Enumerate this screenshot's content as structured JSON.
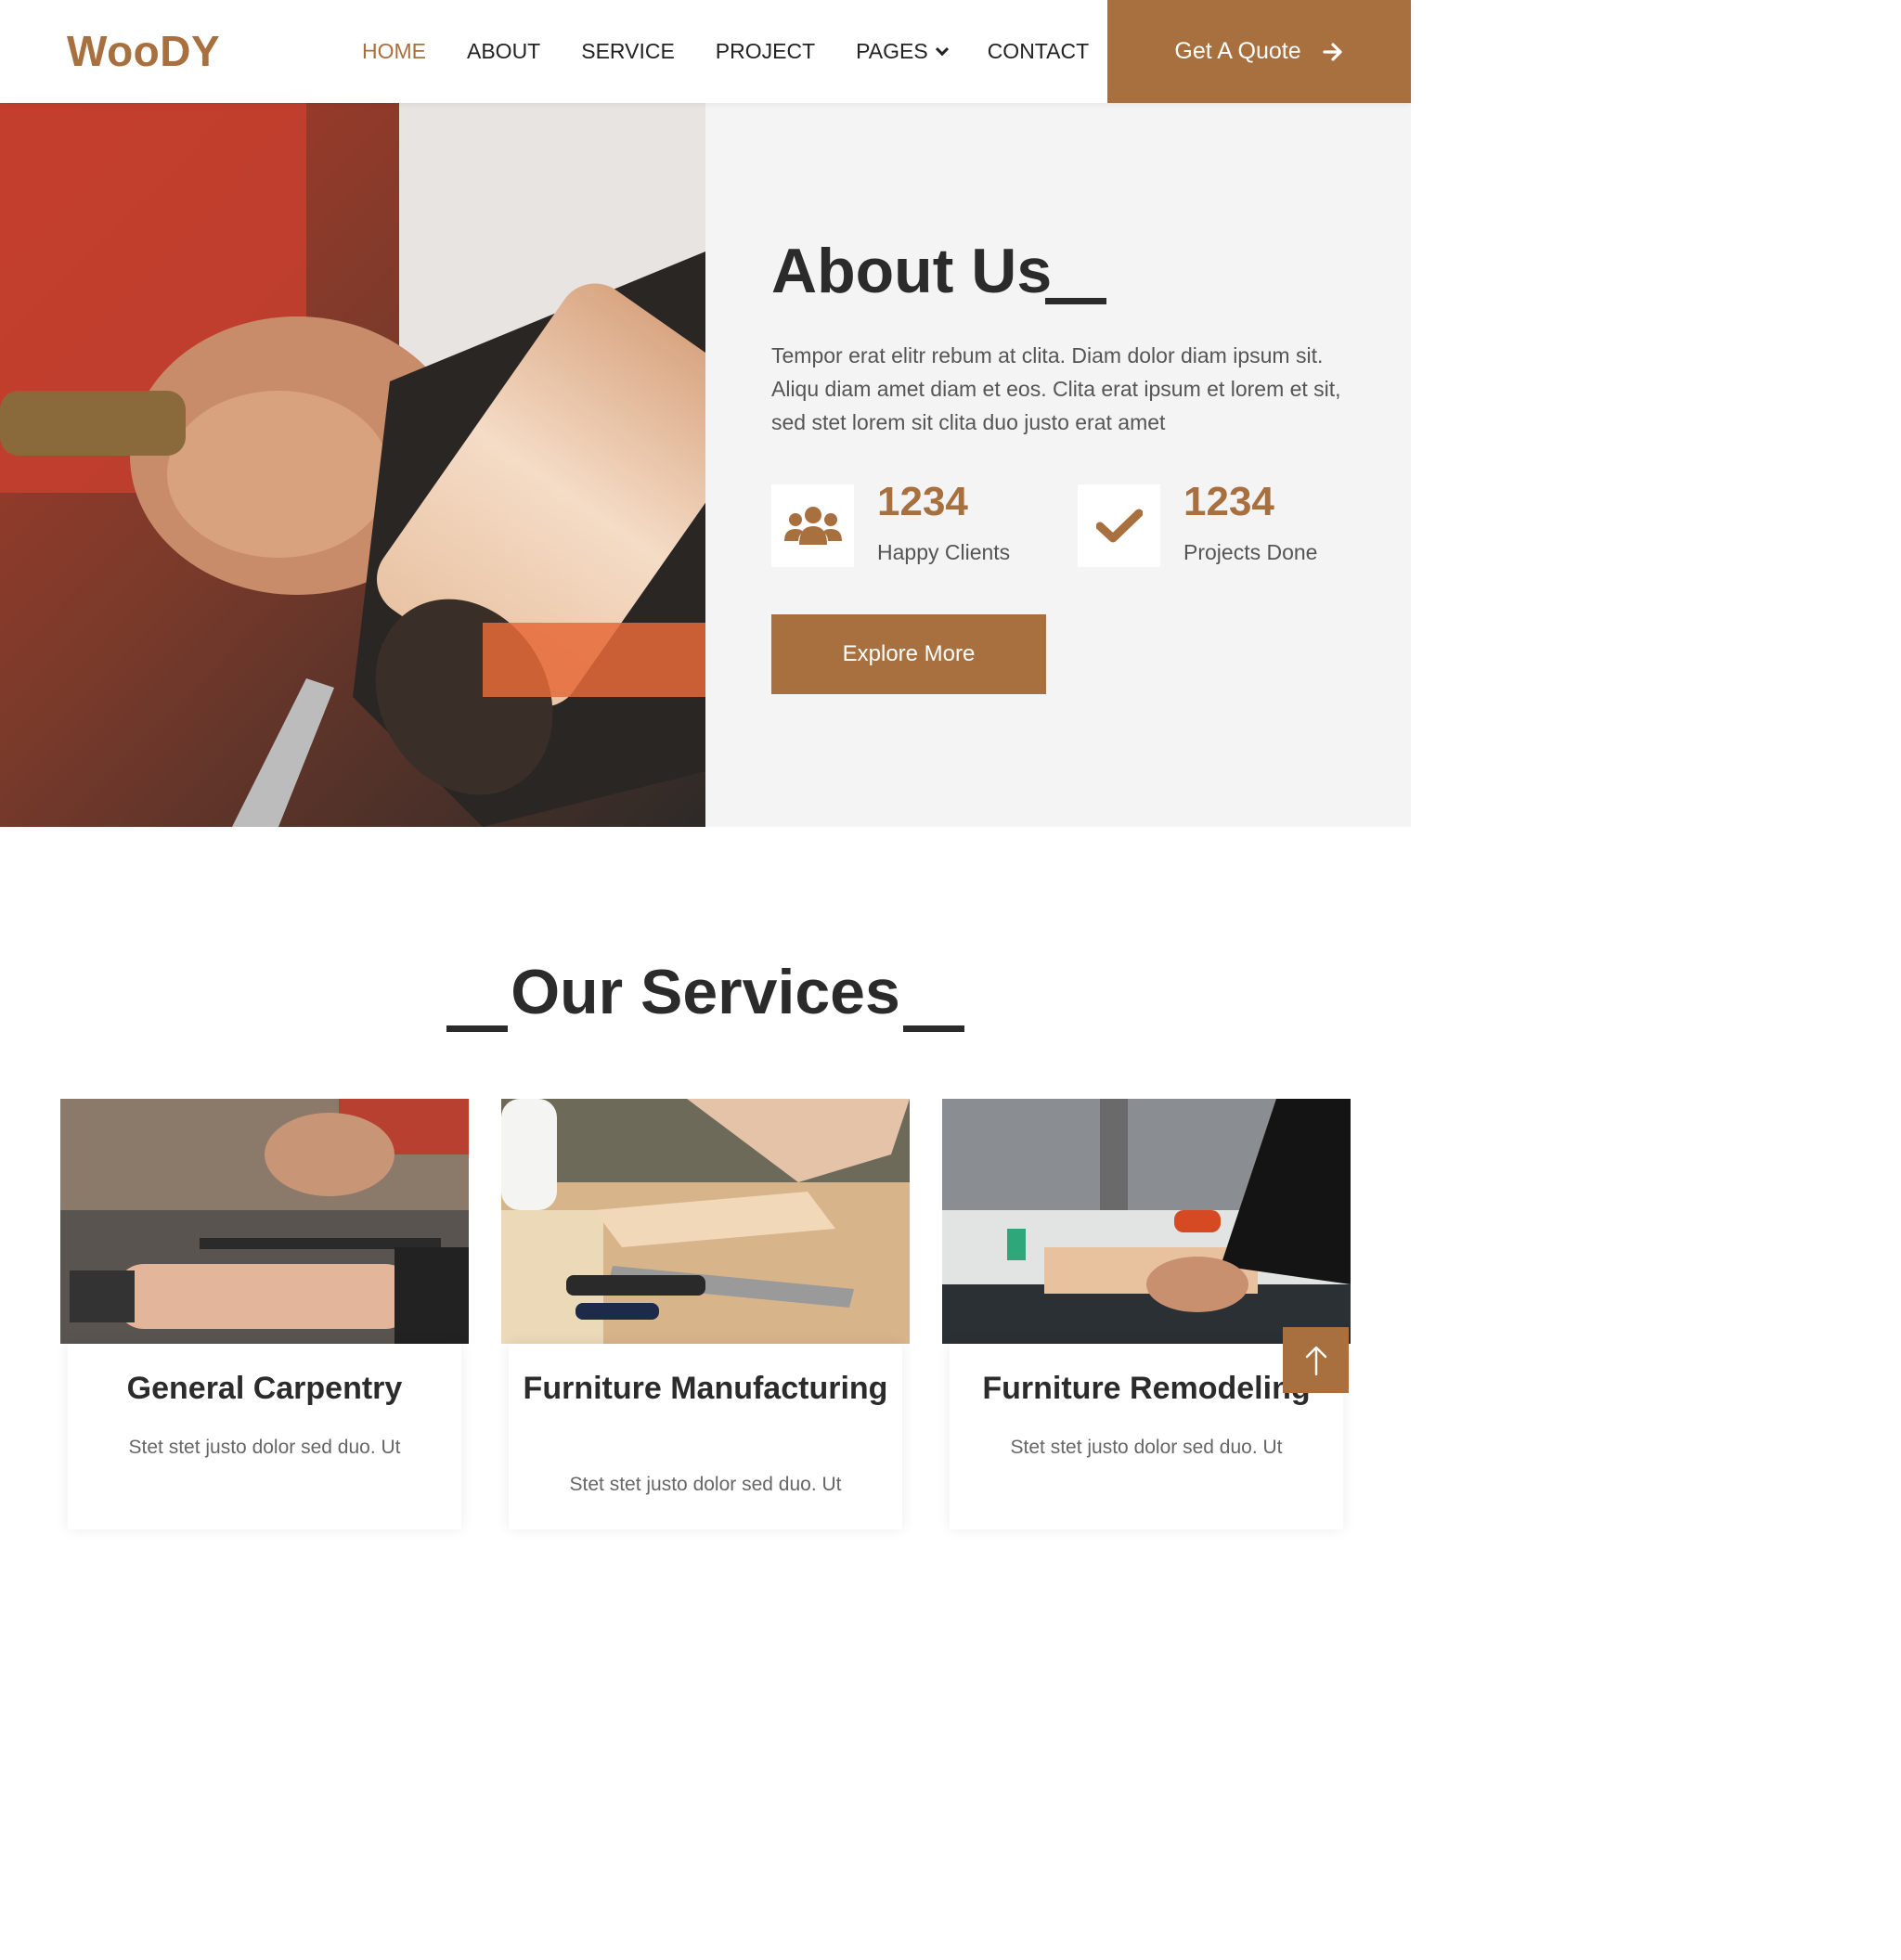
{
  "brand": "WooDY",
  "nav": {
    "items": [
      {
        "label": "HOME",
        "active": true
      },
      {
        "label": "ABOUT"
      },
      {
        "label": "SERVICE"
      },
      {
        "label": "PROJECT"
      },
      {
        "label": "PAGES",
        "dropdown": true
      },
      {
        "label": "CONTACT"
      }
    ],
    "cta": "Get A Quote"
  },
  "about": {
    "title": "About Us",
    "text": "Tempor erat elitr rebum at clita. Diam dolor diam ipsum sit. Aliqu diam amet diam et eos. Clita erat ipsum et lorem et sit, sed stet lorem sit clita duo justo erat amet",
    "stats": [
      {
        "value": "1234",
        "label": "Happy Clients",
        "icon": "users-icon"
      },
      {
        "value": "1234",
        "label": "Projects Done",
        "icon": "check-icon"
      }
    ],
    "button": "Explore More"
  },
  "services": {
    "title": "Our Services",
    "cards": [
      {
        "title": "General Carpentry",
        "text": "Stet stet justo dolor sed duo. Ut"
      },
      {
        "title": "Furniture Manufacturing",
        "text": "Stet stet justo dolor sed duo. Ut"
      },
      {
        "title": "Furniture Remodeling",
        "text": "Stet stet justo dolor sed duo. Ut"
      }
    ]
  },
  "colors": {
    "accent": "#a8703f",
    "dark": "#2b2b2b",
    "panel": "#f4f4f4"
  },
  "icons": {
    "quote_arrow": "arrow-right-icon",
    "back_to_top": "arrow-up-icon"
  }
}
